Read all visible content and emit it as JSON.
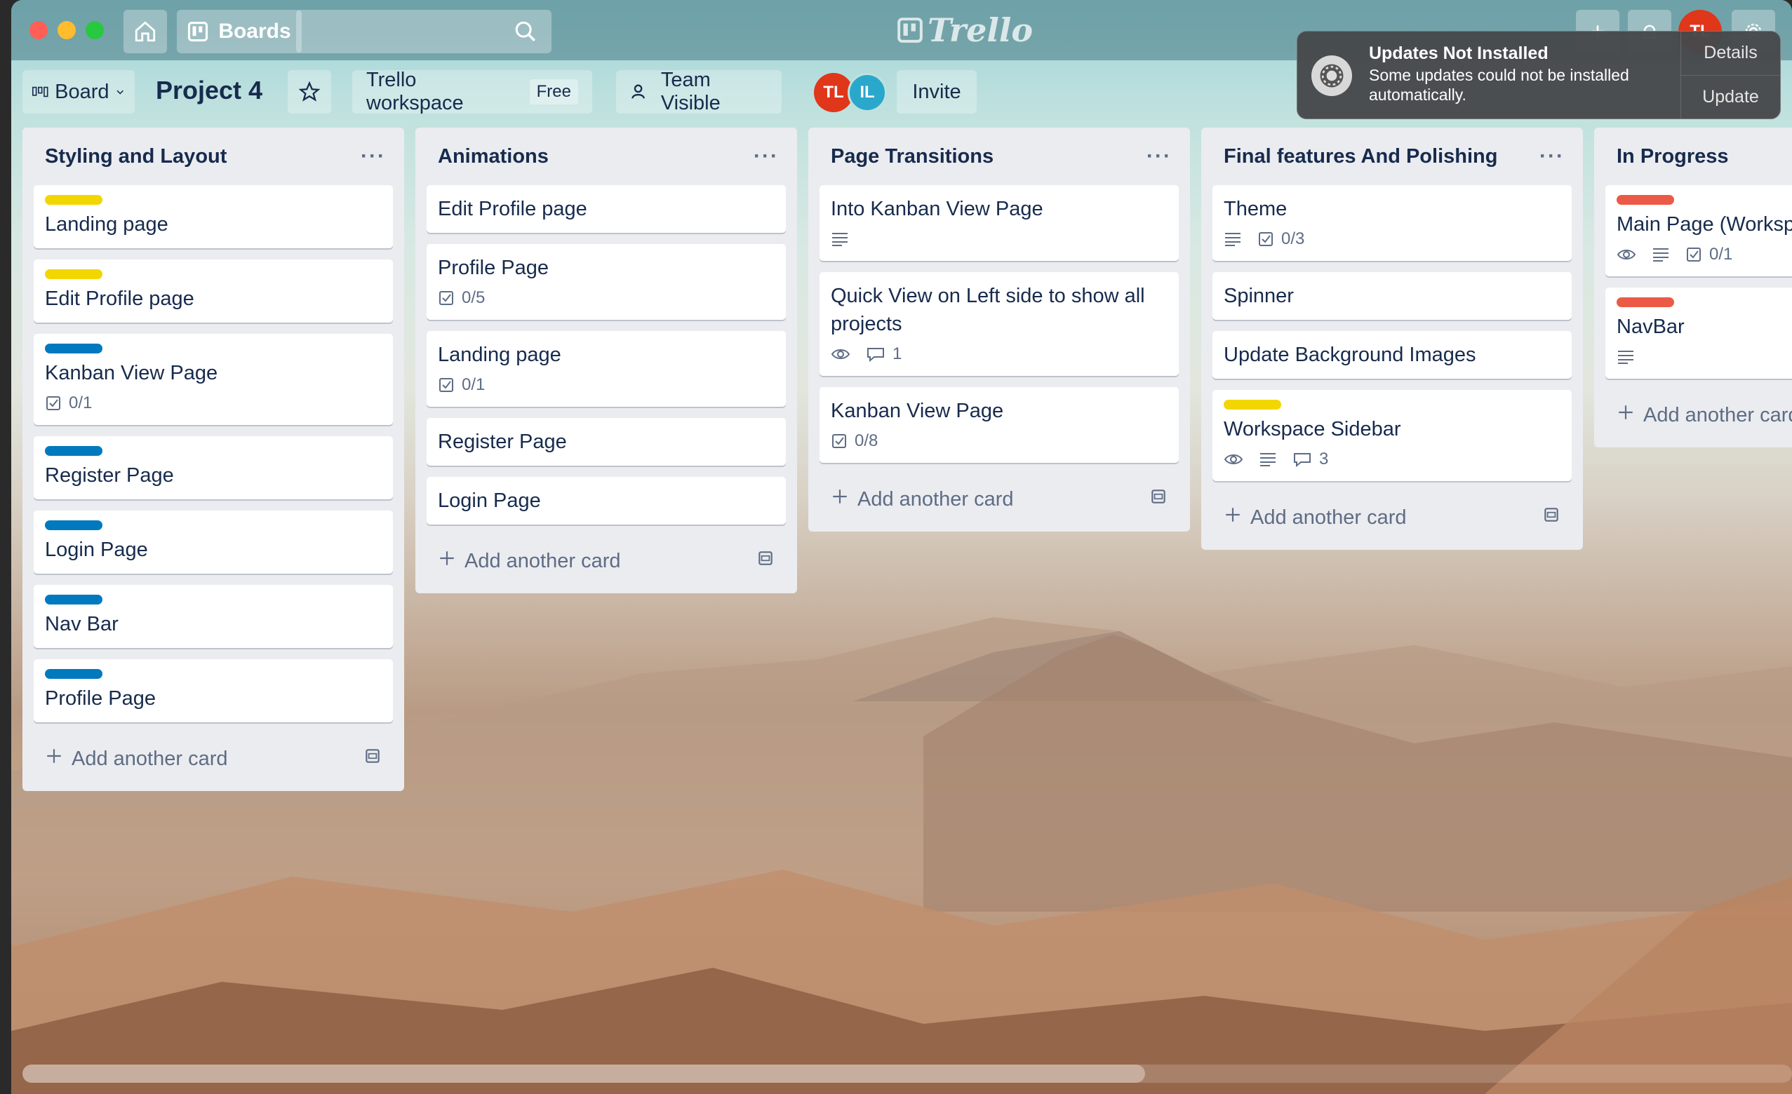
{
  "topbar": {
    "boards_label": "Boards",
    "logo_text": "Trello",
    "avatar_initials": "TL"
  },
  "board": {
    "view_label": "Board",
    "title": "Project 4",
    "workspace_label": "Trello workspace",
    "workspace_plan": "Free",
    "visibility_label": "Team Visible",
    "members": [
      "TL",
      "IL"
    ],
    "invite_label": "Invite"
  },
  "notification": {
    "title": "Updates Not Installed",
    "body": "Some updates could not be installed automatically.",
    "details_label": "Details",
    "update_label": "Update"
  },
  "add_card_label": "Add another card",
  "colors": {
    "yellow": "#f2d600",
    "blue": "#0079bf",
    "red": "#eb5a46"
  },
  "lists": [
    {
      "title": "Styling and Layout",
      "cards": [
        {
          "title": "Landing page",
          "label": "yellow"
        },
        {
          "title": "Edit Profile page",
          "label": "yellow"
        },
        {
          "title": "Kanban View Page",
          "label": "blue",
          "checklist": "0/1"
        },
        {
          "title": "Register Page",
          "label": "blue"
        },
        {
          "title": "Login Page",
          "label": "blue"
        },
        {
          "title": "Nav Bar",
          "label": "blue"
        },
        {
          "title": "Profile Page",
          "label": "blue"
        }
      ]
    },
    {
      "title": "Animations",
      "cards": [
        {
          "title": "Edit Profile page"
        },
        {
          "title": "Profile Page",
          "checklist": "0/5"
        },
        {
          "title": "Landing page",
          "checklist": "0/1"
        },
        {
          "title": "Register Page"
        },
        {
          "title": "Login Page"
        }
      ]
    },
    {
      "title": "Page Transitions",
      "cards": [
        {
          "title": "Into Kanban View Page",
          "description": true
        },
        {
          "title": "Quick View on Left side to show all projects",
          "watch": true,
          "comments": "1"
        },
        {
          "title": "Kanban View Page",
          "checklist": "0/8"
        }
      ]
    },
    {
      "title": "Final features And Polishing",
      "cards": [
        {
          "title": "Theme",
          "description": true,
          "checklist": "0/3"
        },
        {
          "title": "Spinner"
        },
        {
          "title": "Update Background Images"
        },
        {
          "title": "Workspace Sidebar",
          "label": "yellow",
          "watch": true,
          "description": true,
          "comments": "3"
        }
      ]
    },
    {
      "title": "In Progress",
      "cards": [
        {
          "title": "Main Page (Worksp",
          "label": "red",
          "watch": true,
          "description": true,
          "checklist": "0/1"
        },
        {
          "title": "NavBar",
          "label": "red",
          "description": true
        }
      ]
    }
  ]
}
